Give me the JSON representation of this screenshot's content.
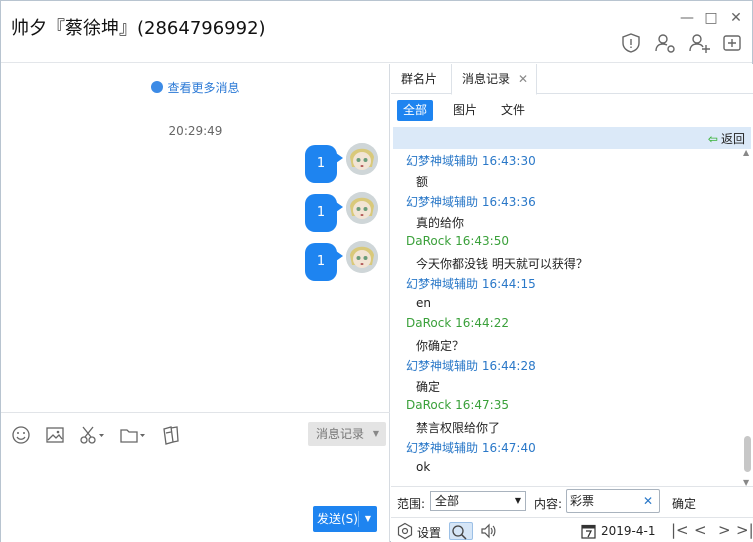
{
  "window": {
    "title": "帅夕『蔡徐坤』(2864796992)",
    "minimize_glyph": "—",
    "maximize_glyph": "□",
    "close_glyph": "✕"
  },
  "chat": {
    "more_messages": "查看更多消息",
    "time": "20:29:49",
    "messages": [
      "1",
      "1",
      "1"
    ]
  },
  "composer": {
    "history_button": "消息记录",
    "send_button": "发送(S)"
  },
  "side_panel": {
    "tabs": [
      "群名片",
      "消息记录"
    ],
    "filters": [
      "全部",
      "图片",
      "文件"
    ],
    "back_label": "返回",
    "records": [
      {
        "sender": "幻梦神域辅助 16:43:30",
        "kind": "a",
        "text": "额"
      },
      {
        "sender": "幻梦神域辅助 16:43:36",
        "kind": "a",
        "text": "真的给你"
      },
      {
        "sender": "DaRock 16:43:50",
        "kind": "b",
        "text": "今天你都没钱 明天就可以获得？"
      },
      {
        "sender": "幻梦神域辅助 16:44:15",
        "kind": "a",
        "text": "en"
      },
      {
        "sender": "DaRock 16:44:22",
        "kind": "b",
        "text": "你确定？"
      },
      {
        "sender": "幻梦神域辅助 16:44:28",
        "kind": "a",
        "text": "确定"
      },
      {
        "sender": "DaRock 16:47:35",
        "kind": "b",
        "text": "禁言权限给你了"
      },
      {
        "sender": "幻梦神域辅助 16:47:40",
        "kind": "a",
        "text": "ok"
      }
    ],
    "search": {
      "range_label": "范围:",
      "range_value": "全部",
      "content_label": "内容:",
      "content_value": "彩票",
      "confirm": "确定"
    },
    "bottom": {
      "settings": "设置",
      "date": "2019-4-1"
    }
  }
}
